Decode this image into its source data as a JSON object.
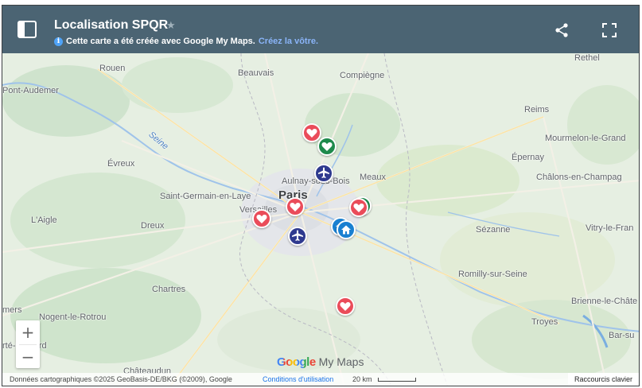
{
  "header": {
    "title": "Localisation SPQR",
    "info_text": "Cette carte a été créée avec Google My Maps.",
    "create_link": "Créez la vôtre."
  },
  "map": {
    "labels": {
      "rouen": "Rouen",
      "beauvais": "Beauvais",
      "compiegne": "Compiègne",
      "rethel": "Rethel",
      "pont_audemer": "Pont-Audemer",
      "reims": "Reims",
      "seine": "Seine",
      "mourmelon": "Mourmelon-le-Grand",
      "epernay": "Épernay",
      "evreux": "Évreux",
      "aulnay": "Aulnay-sous-Bois",
      "meaux": "Meaux",
      "chalons": "Châlons-en-Champag",
      "saint_germain": "Saint-Germain-en-Laye",
      "paris": "Paris",
      "versailles": "Versailles",
      "laigle": "L'Aigle",
      "dreux": "Dreux",
      "sezanne": "Sézanne",
      "vitry": "Vitry-le-Fran",
      "chartres": "Chartres",
      "romilly": "Romilly-sur-Seine",
      "mers": "mers",
      "nogent": "Nogent-le-Rotrou",
      "brienne": "Brienne-le-Châte",
      "troyes": "Troyes",
      "bernard": "rté-Bernard",
      "bar": "Bar-su",
      "chateaudun": "Châteaudun"
    }
  },
  "zoom": {
    "in_label": "+",
    "out_label": "−"
  },
  "branding": {
    "google": "Google",
    "my_maps": "My Maps"
  },
  "footer": {
    "attribution": "Données cartographiques ©2025 GeoBasis-DE/BKG (©2009), Google",
    "terms": "Conditions d'utilisation",
    "scale": "20 km",
    "shortcuts": "Raccourcis clavier"
  },
  "icons": {
    "sidebar": "sidebar-toggle-icon",
    "share": "share-icon",
    "fullscreen": "fullscreen-icon",
    "heart": "heart-icon",
    "airplane": "airplane-icon",
    "home": "home-icon",
    "info": "info-icon"
  },
  "colors": {
    "header": "#4b6473",
    "marker_red": "#ea4c5a",
    "marker_green": "#1e8a4c",
    "marker_navy": "#2f3a8f",
    "marker_blue": "#1a80d1"
  }
}
